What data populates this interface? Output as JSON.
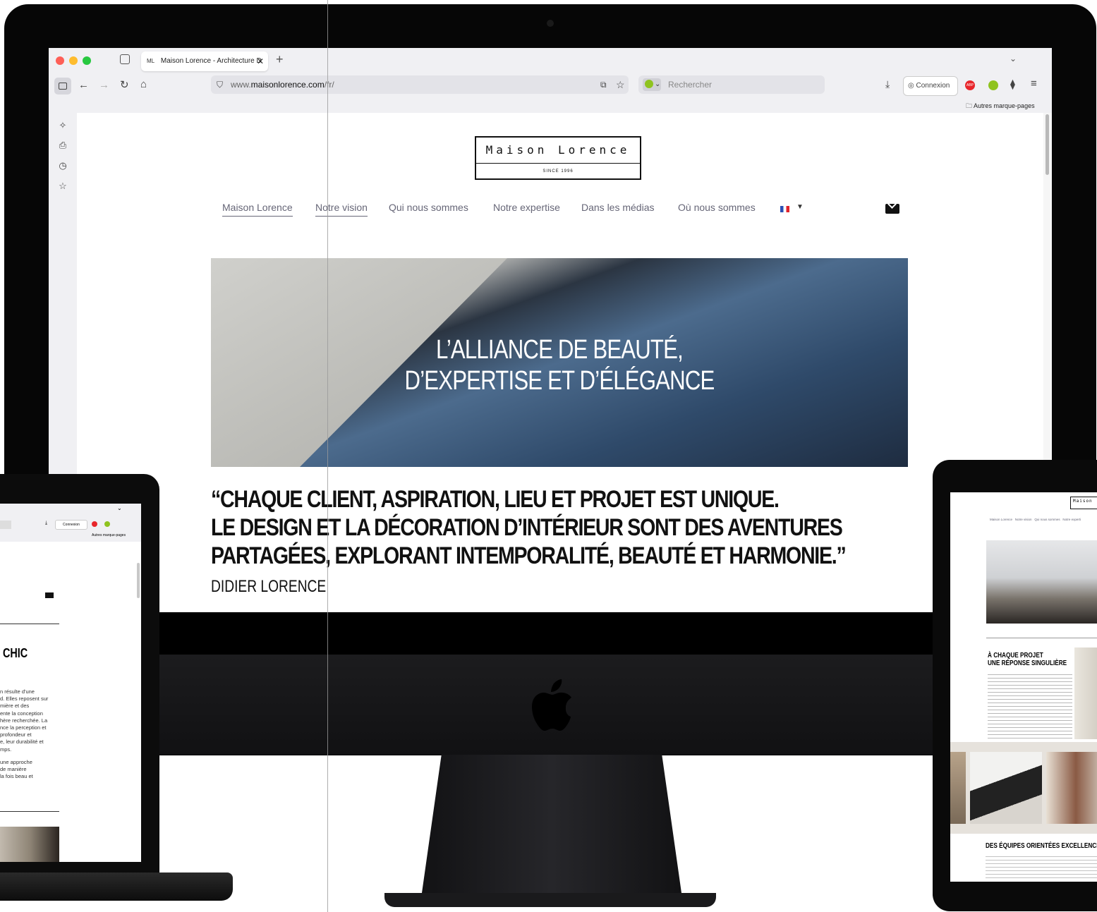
{
  "browser": {
    "tab_title": "Maison Lorence - Architecture D",
    "tab_favicon": "ML",
    "new_tab": "+",
    "url_prefix": "www.",
    "url_domain": "maisonlorence.com",
    "url_path": "/fr/",
    "search_placeholder": "Rechercher",
    "connexion_label": "Connexion",
    "bookmarks_label": "Autres marque-pages"
  },
  "site": {
    "logo_name": "Maison Lorence",
    "logo_since": "SINCE 1996",
    "nav": [
      "Maison Lorence",
      "Notre vision",
      "Qui nous sommes",
      "Notre expertise",
      "Dans les médias",
      "Où nous sommes"
    ],
    "hero_line1": "L’ALLIANCE DE BEAUTÉ,",
    "hero_line2": "D’EXPERTISE ET D’ÉLÉGANCE",
    "quote_line1": "“CHAQUE CLIENT, ASPIRATION, LIEU ET PROJET EST UNIQUE.",
    "quote_line2": "LE DESIGN ET LA DÉCORATION D’INTÉRIEUR SONT DES AVENTURES",
    "quote_line3": "PARTAGÉES, EXPLORANT INTEMPORALITÉ, BEAUTÉ ET HARMONIE.”",
    "author": "DIDIER LORENCE"
  },
  "laptop": {
    "connexion_label": "Connexion",
    "bookmarks_label": "Autres marque-pages",
    "heading": "CHIC",
    "para1": [
      "n résulte d'une",
      "d. Elles reposent sur",
      "mière et des",
      "ente la conception",
      "hère recherchée. La",
      "nce la perception et",
      "profondeur et",
      "e, leur durabilité et",
      "mps."
    ],
    "para2": [
      "une approche",
      "de manière",
      "la fois beau et"
    ]
  },
  "tablet": {
    "logo_fragment": "Maison",
    "nav": [
      "Maison Lorence",
      "Notre vision",
      "Qui nous sommes",
      "Notre experti"
    ],
    "heading_line1": "À CHAQUE PROJET",
    "heading_line2": "UNE RÉPONSE SINGULIÈRE",
    "heading2": "DES ÉQUIPES ORIENTÉES EXCELLENCE"
  },
  "colors": {
    "nav_text": "#667788",
    "bezel": "#060606",
    "browser_chrome": "#f0f0f3"
  },
  "icons": [
    "sidebar-toggle-icon",
    "back-icon",
    "forward-icon",
    "reload-icon",
    "home-icon",
    "shield-icon",
    "translate-icon",
    "star-icon",
    "download-icon",
    "account-icon",
    "abp-icon",
    "extension-icon",
    "puzzle-icon",
    "menu-icon",
    "folder-icon",
    "envelope-icon",
    "flag-fr-icon",
    "apple-logo-icon"
  ]
}
